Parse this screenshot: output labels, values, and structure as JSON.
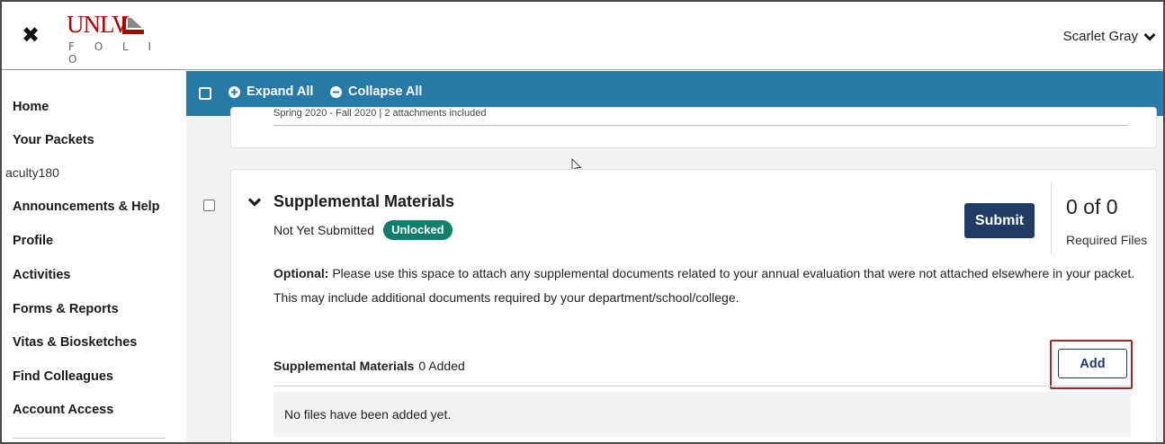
{
  "header": {
    "close_icon": "close-icon",
    "logo_text": "UNLV",
    "logo_sub": "F O L I O",
    "user_name": "Scarlet Gray",
    "brand_color": "#b10202"
  },
  "sidebar": {
    "items": [
      {
        "label": "Home"
      },
      {
        "label": "Your Packets"
      },
      {
        "label": "aculty180"
      },
      {
        "label": "Announcements & Help"
      },
      {
        "label": "Profile"
      },
      {
        "label": "Activities"
      },
      {
        "label": "Forms & Reports"
      },
      {
        "label": "Vitas & Biosketches"
      },
      {
        "label": "Find Colleagues"
      },
      {
        "label": "Account Access"
      }
    ]
  },
  "toolbar": {
    "expand_all": "Expand All",
    "collapse_all": "Collapse All",
    "color": "#2779a7"
  },
  "previous_card": {
    "meta": "Spring 2020 - Fall 2020 | 2 attachments included"
  },
  "card": {
    "title": "Supplemental Materials",
    "status": "Not Yet Submitted",
    "badge": "Unlocked",
    "submit_label": "Submit",
    "counter": "0 of 0",
    "counter_label": "Required Files",
    "desc_optional": "Optional:",
    "desc_line1": " Please use this space to attach any supplemental documents related to your annual evaluation that were not attached elsewhere in your packet.",
    "desc_line2": "This may include additional documents required by your department/school/college.",
    "section_name": "Supplemental Materials",
    "section_count": "0 Added",
    "add_label": "Add",
    "empty_text": "No files have been added yet."
  }
}
